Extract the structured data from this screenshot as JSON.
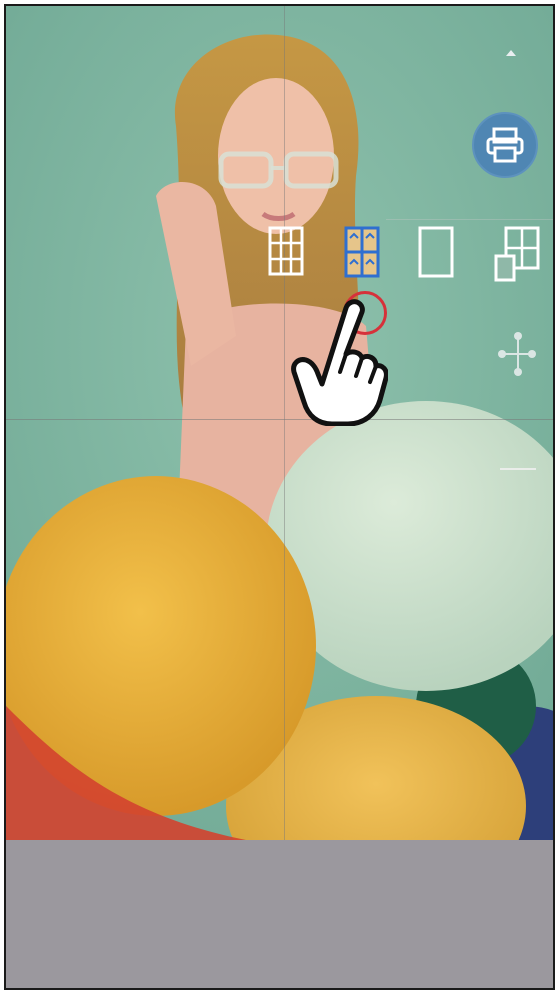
{
  "print": {
    "icon": "printer-icon"
  },
  "layout_options": [
    {
      "icon": "grid-3x3-icon",
      "selected": false
    },
    {
      "icon": "grid-2x2-icon",
      "selected": true
    },
    {
      "icon": "single-frame-icon",
      "selected": false
    },
    {
      "icon": "collage-icon",
      "selected": false
    }
  ],
  "share": {
    "icon": "share-icon"
  },
  "colors": {
    "accent_blue": "#4f86b3",
    "selected_layout": "#2f6fd0",
    "tap_indicator": "#d6313a",
    "bottom_panel": "#9b989e"
  }
}
